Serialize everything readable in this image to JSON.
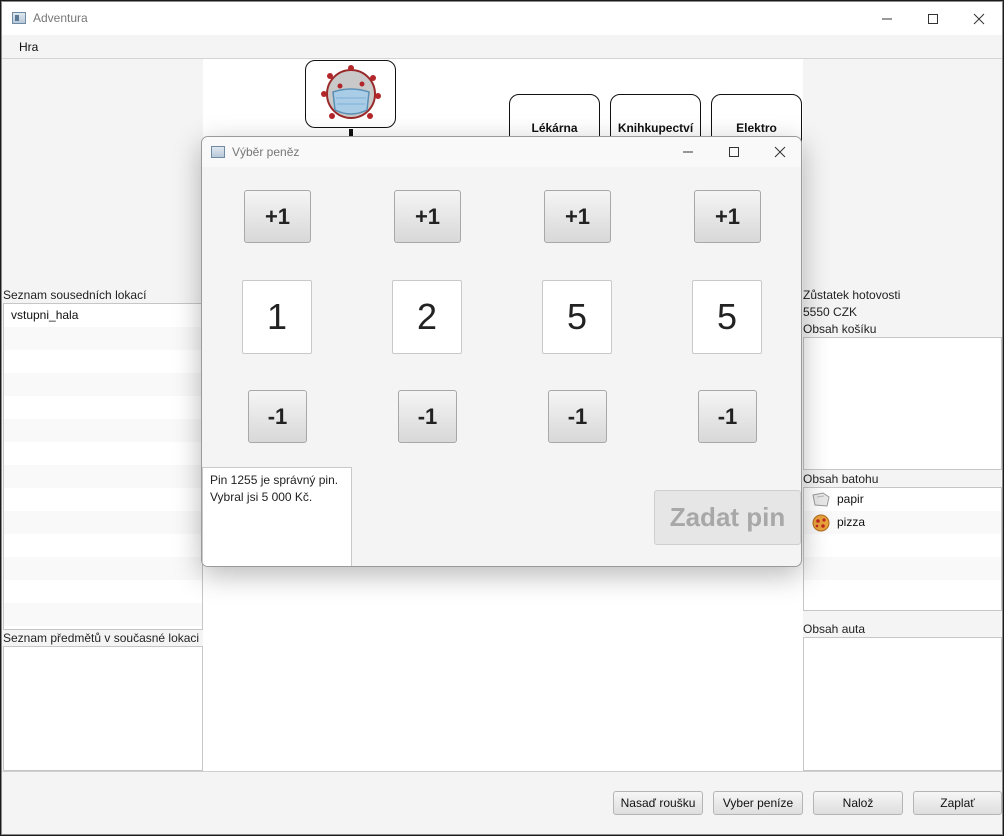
{
  "window": {
    "title": "Adventura",
    "menu": "Hra"
  },
  "map": {
    "locations": [
      "Lékárna",
      "Knihkupectví",
      "Elektro"
    ]
  },
  "left": {
    "neighbors_label": "Seznam sousedních lokací",
    "neighbors": [
      "vstupni_hala"
    ],
    "items_label": "Seznam předmětů v současné lokaci"
  },
  "right": {
    "cash_label": "Zůstatek hotovosti",
    "cash_value": "5550 CZK",
    "basket_label": "Obsah košíku",
    "backpack_label": "Obsah batohu",
    "backpack": [
      {
        "name": "papir",
        "icon": "paper-icon"
      },
      {
        "name": "pizza",
        "icon": "pizza-icon"
      }
    ],
    "car_label": "Obsah auta"
  },
  "buttons": {
    "mask": "Nasaď roušku",
    "withdraw": "Vyber peníze",
    "load": "Nalož",
    "pay": "Zaplať"
  },
  "dialog": {
    "title": "Výběr peněz",
    "plus_label": "+1",
    "minus_label": "-1",
    "digits": [
      "1",
      "2",
      "5",
      "5"
    ],
    "message_line1": "Pin 1255 je správný pin.",
    "message_line2": "Vybral jsi 5 000 Kč.",
    "pin_button": "Zadat pin"
  }
}
